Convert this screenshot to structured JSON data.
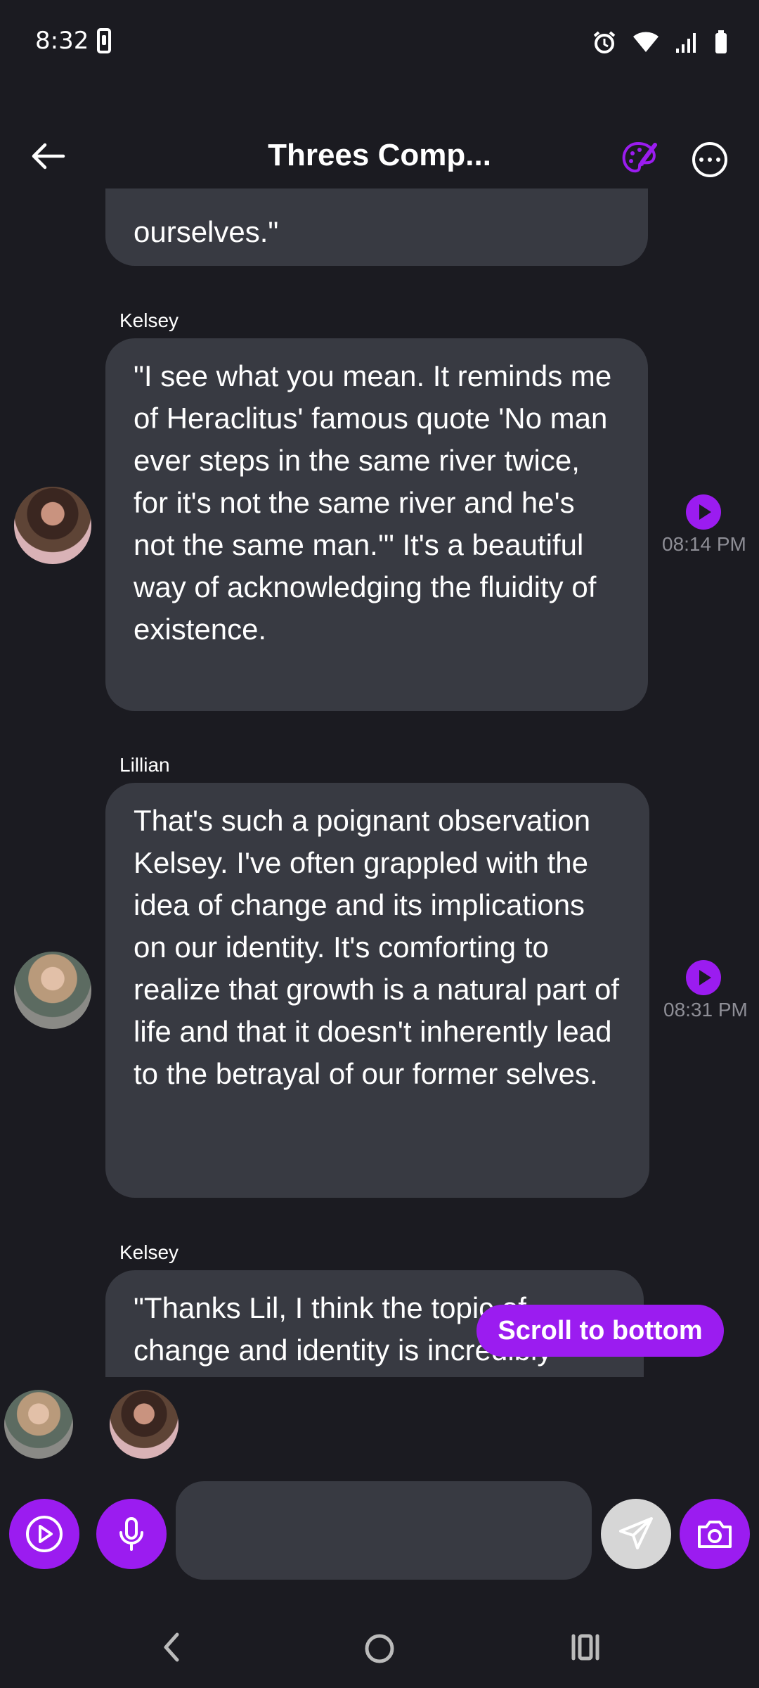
{
  "status_bar": {
    "time": "8:32"
  },
  "header": {
    "title": "Threes Comp..."
  },
  "messages": {
    "partial_top": {
      "text": "ourselves.\""
    },
    "m1": {
      "sender": "Kelsey",
      "text": "\"I see what you mean. It reminds me of Heraclitus' famous quote 'No man ever steps in the same river twice, for it's not the same river and he's not the same man.'\" It's a beautiful way of acknowledging the fluidity of existence.",
      "time": "08:14 PM"
    },
    "m2": {
      "sender": "Lillian",
      "text": "That's such a poignant observation Kelsey. I've often grappled with the idea of change and its implications on our identity. It's comforting to realize that growth is a natural part of life and that it doesn't inherently lead to the betrayal of our former selves.",
      "time": "08:31 PM"
    },
    "m3": {
      "sender": "Kelsey",
      "text": "\"Thanks Lil, I think the topic of change and identity is incredibly"
    }
  },
  "scroll_to_bottom": {
    "label": "Scroll to bottom"
  },
  "composer": {
    "value": "",
    "placeholder": ""
  },
  "colors": {
    "accent": "#9b1cf0",
    "background": "#1b1b21",
    "bubble": "#383a42"
  }
}
